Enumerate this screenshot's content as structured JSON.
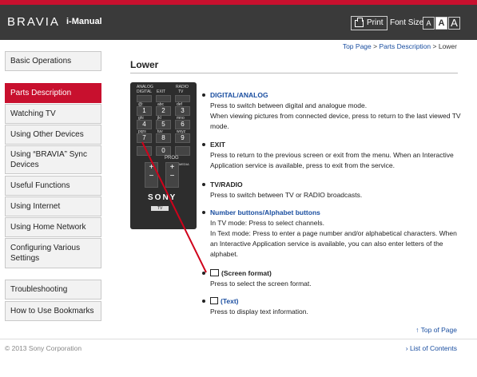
{
  "header": {
    "brand": "BRAVIA",
    "title": "i-Manual",
    "print_label": "Print",
    "font_size_label": "Font Size",
    "font_sizes": [
      "A",
      "A",
      "A"
    ]
  },
  "breadcrumb": {
    "top_page": "Top Page",
    "sep1": " > ",
    "parts": "Parts Description",
    "sep2": " > ",
    "current": "Lower"
  },
  "page_title": "Lower",
  "sidebar": {
    "items": [
      {
        "label": "Basic Operations"
      },
      {
        "label": "Parts Description"
      },
      {
        "label": "Watching TV"
      },
      {
        "label": "Using Other Devices"
      },
      {
        "label": "Using “BRAVIA” Sync Devices"
      },
      {
        "label": "Useful Functions"
      },
      {
        "label": "Using Internet"
      },
      {
        "label": "Using Home Network"
      },
      {
        "label": "Configuring Various Settings"
      },
      {
        "label": "Troubleshooting"
      },
      {
        "label": "How to Use Bookmarks"
      }
    ]
  },
  "remote": {
    "top_labels": [
      "ANALOG",
      "DIGITAL",
      "EXIT",
      "RADIO",
      "TV"
    ],
    "keys": [
      "1",
      "2",
      "3",
      "4",
      "5",
      "6",
      "7",
      "8",
      "9",
      "0"
    ],
    "sub_labels": [
      "@:",
      "abc",
      "def",
      "ghi",
      "jkl",
      "mno",
      "pqrs",
      "tuv",
      "wxyz"
    ],
    "prog_label": "PROG",
    "media_label": "MEDIA",
    "brand": "SONY",
    "tv_label": "TV"
  },
  "items": [
    {
      "title": "DIGITAL/ANALOG",
      "desc": [
        "Press to switch between digital and analogue mode.",
        "When viewing pictures from connected device, press to return to the last viewed TV mode."
      ]
    },
    {
      "title": "EXIT",
      "desc": [
        "Press to return to the previous screen or exit from the menu. When an Interactive Application service is available, press to exit from the service."
      ]
    },
    {
      "title": "TV/RADIO",
      "desc": [
        "Press to switch between TV or RADIO broadcasts."
      ]
    },
    {
      "title": "Number buttons/Alphabet buttons",
      "desc": [
        "In TV mode: Press to select channels.",
        "In Text mode: Press to enter a page number and/or alphabetical characters. When an Interactive Application service is available, you can also enter letters of the alphabet."
      ]
    },
    {
      "title": "(Screen format)",
      "desc": [
        "Press to select the screen format."
      ]
    },
    {
      "title": "(Text)",
      "desc": [
        "Press to display text information."
      ]
    }
  ],
  "top_of_page": "Top of Page",
  "copyright": "© 2013 Sony Corporation",
  "list_of_contents": "List of Contents",
  "colors": {
    "accent": "#c8102e",
    "header_bg": "#3a3a3a",
    "link": "#1a4ea0"
  }
}
